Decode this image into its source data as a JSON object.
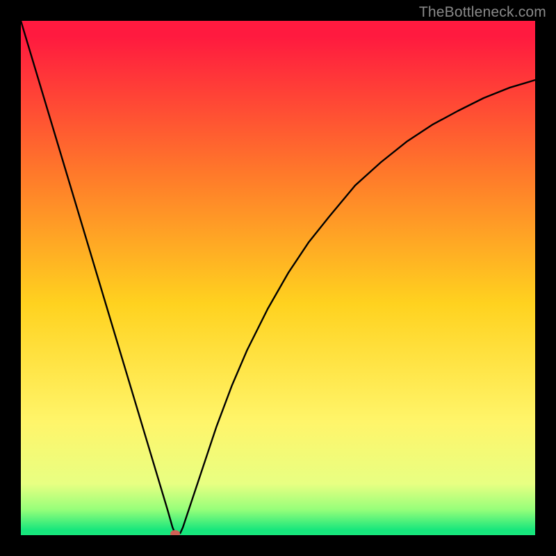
{
  "watermark": "TheBottleneck.com",
  "chart_data": {
    "type": "line",
    "title": "",
    "xlabel": "",
    "ylabel": "",
    "x_range": [
      0,
      100
    ],
    "y_range": [
      0,
      100
    ],
    "background_gradient": {
      "stops": [
        {
          "offset": 0.0,
          "color": "#ff1a3f"
        },
        {
          "offset": 0.03,
          "color": "#ff1a3f"
        },
        {
          "offset": 0.3,
          "color": "#ff7a2a"
        },
        {
          "offset": 0.55,
          "color": "#ffd21f"
        },
        {
          "offset": 0.78,
          "color": "#fff56a"
        },
        {
          "offset": 0.9,
          "color": "#e8ff82"
        },
        {
          "offset": 0.95,
          "color": "#97ff7a"
        },
        {
          "offset": 0.99,
          "color": "#17e67c"
        },
        {
          "offset": 1.0,
          "color": "#17e67c"
        }
      ]
    },
    "curve": {
      "name": "bottleneck",
      "color": "#000000",
      "stroke_width": 2.4,
      "min_x": 30,
      "points": [
        {
          "x": 0,
          "y": 100
        },
        {
          "x": 3,
          "y": 90
        },
        {
          "x": 6,
          "y": 80
        },
        {
          "x": 9,
          "y": 70
        },
        {
          "x": 12,
          "y": 60
        },
        {
          "x": 15,
          "y": 50
        },
        {
          "x": 18,
          "y": 40
        },
        {
          "x": 21,
          "y": 30
        },
        {
          "x": 24,
          "y": 20
        },
        {
          "x": 27,
          "y": 10
        },
        {
          "x": 28.5,
          "y": 5
        },
        {
          "x": 29.5,
          "y": 1.5
        },
        {
          "x": 30.0,
          "y": 0.3
        },
        {
          "x": 30.5,
          "y": 0.3
        },
        {
          "x": 31.0,
          "y": 0.4
        },
        {
          "x": 31.5,
          "y": 1.5
        },
        {
          "x": 33,
          "y": 6
        },
        {
          "x": 35,
          "y": 12
        },
        {
          "x": 38,
          "y": 21
        },
        {
          "x": 41,
          "y": 29
        },
        {
          "x": 44,
          "y": 36
        },
        {
          "x": 48,
          "y": 44
        },
        {
          "x": 52,
          "y": 51
        },
        {
          "x": 56,
          "y": 57
        },
        {
          "x": 60,
          "y": 62
        },
        {
          "x": 65,
          "y": 68
        },
        {
          "x": 70,
          "y": 72.5
        },
        {
          "x": 75,
          "y": 76.5
        },
        {
          "x": 80,
          "y": 79.8
        },
        {
          "x": 85,
          "y": 82.5
        },
        {
          "x": 90,
          "y": 85
        },
        {
          "x": 95,
          "y": 87
        },
        {
          "x": 100,
          "y": 88.5
        }
      ]
    },
    "marker": {
      "x": 30,
      "y": 0.3,
      "rx": 7,
      "ry": 5,
      "color": "#d06056"
    }
  }
}
